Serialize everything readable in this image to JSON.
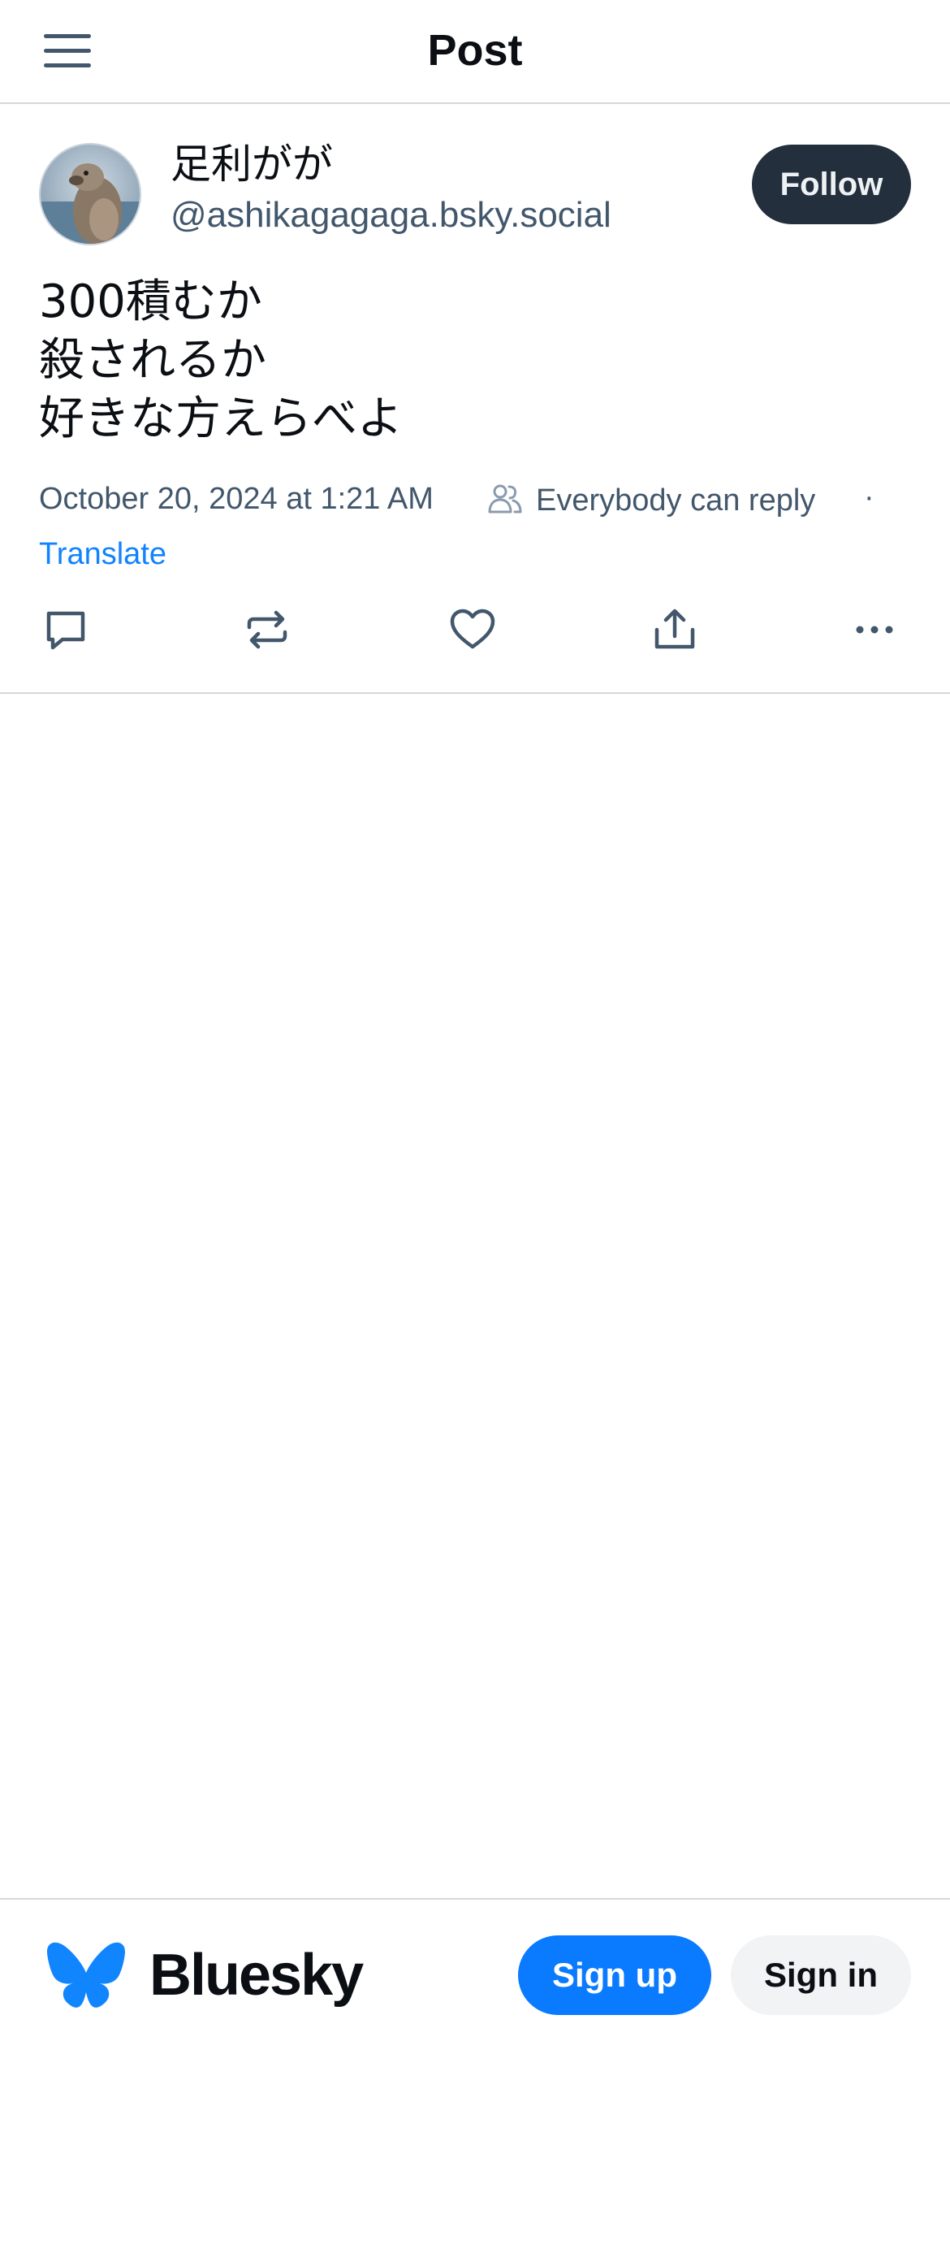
{
  "header": {
    "title": "Post",
    "menu_icon": "hamburger-menu-icon"
  },
  "post": {
    "author": {
      "display_name": "足利がが",
      "handle": "@ashikagagaga.bsky.social",
      "avatar_icon": "sea-lion-avatar"
    },
    "follow_label": "Follow",
    "text_lines": [
      "300積むか",
      "殺されるか",
      "好きな方えらべよ"
    ],
    "timestamp": "October 20, 2024 at 1:21 AM",
    "reply_setting": "Everybody can reply",
    "separator": "·",
    "translate_label": "Translate",
    "actions": {
      "reply_icon": "comment-icon",
      "repost_icon": "repost-icon",
      "like_icon": "heart-icon",
      "share_icon": "share-icon",
      "more_icon": "more-options-icon"
    }
  },
  "footer": {
    "brand": "Bluesky",
    "logo_icon": "butterfly-icon",
    "signup_label": "Sign up",
    "signin_label": "Sign in"
  },
  "colors": {
    "text_primary": "#0b0f14",
    "text_secondary": "#42576c",
    "link": "#1083fe",
    "brand_blue": "#0a7aff",
    "follow_bg": "#232f3c",
    "divider": "#d4d9de"
  }
}
